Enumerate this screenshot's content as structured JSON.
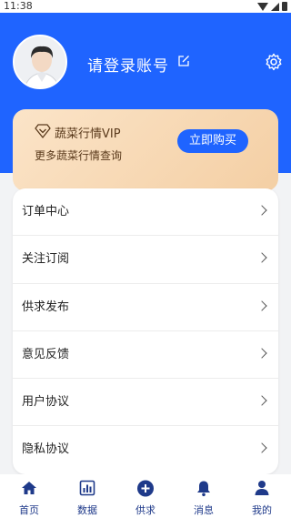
{
  "status_bar": {
    "time": "11:38"
  },
  "header": {
    "login_text": "请登录账号"
  },
  "vip": {
    "title": "蔬菜行情VIP",
    "subtitle": "更多蔬菜行情查询",
    "buy_label": "立即购买"
  },
  "menu": {
    "items": [
      {
        "label": "订单中心"
      },
      {
        "label": "关注订阅"
      },
      {
        "label": "供求发布"
      },
      {
        "label": "意见反馈"
      },
      {
        "label": "用户协议"
      },
      {
        "label": "隐私协议"
      }
    ]
  },
  "tabs": [
    {
      "label": "首页",
      "icon": "home-icon"
    },
    {
      "label": "数据",
      "icon": "chart-icon"
    },
    {
      "label": "供求",
      "icon": "plus-circle-icon"
    },
    {
      "label": "消息",
      "icon": "bell-icon"
    },
    {
      "label": "我的",
      "icon": "user-icon"
    }
  ],
  "colors": {
    "primary": "#1f64ff",
    "vip_gold": "#f4cfa4",
    "tab_text": "#1f3a8a"
  }
}
